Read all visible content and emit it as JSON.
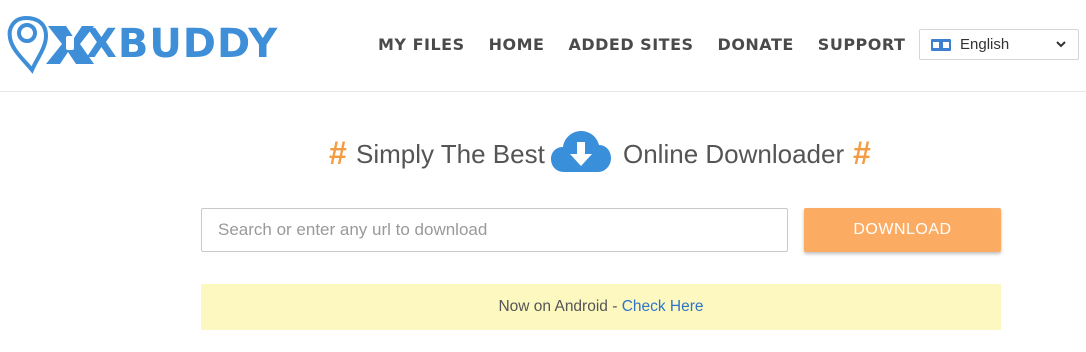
{
  "brand": {
    "logo_text": "XBUDDY",
    "logo_mark": "9",
    "accent": "#3e8ed8"
  },
  "nav": {
    "items": [
      {
        "label": "MY FILES"
      },
      {
        "label": "HOME"
      },
      {
        "label": "ADDED SITES"
      },
      {
        "label": "DONATE"
      },
      {
        "label": "SUPPORT"
      }
    ]
  },
  "language": {
    "selected": "English",
    "icon": "language-flag-icon"
  },
  "hero": {
    "hash_left": "#",
    "text_left": "Simply The Best",
    "icon": "cloud-download-icon",
    "text_right": "Online Downloader",
    "hash_right": "#",
    "hash_color": "#f39c42"
  },
  "search": {
    "placeholder": "Search or enter any url to download",
    "value": ""
  },
  "download_button": {
    "label": "DOWNLOAD",
    "color": "#fbab62"
  },
  "notice": {
    "text": "Now on Android - ",
    "link": "Check Here",
    "background": "#fdf8c0",
    "link_color": "#2e75c9"
  }
}
